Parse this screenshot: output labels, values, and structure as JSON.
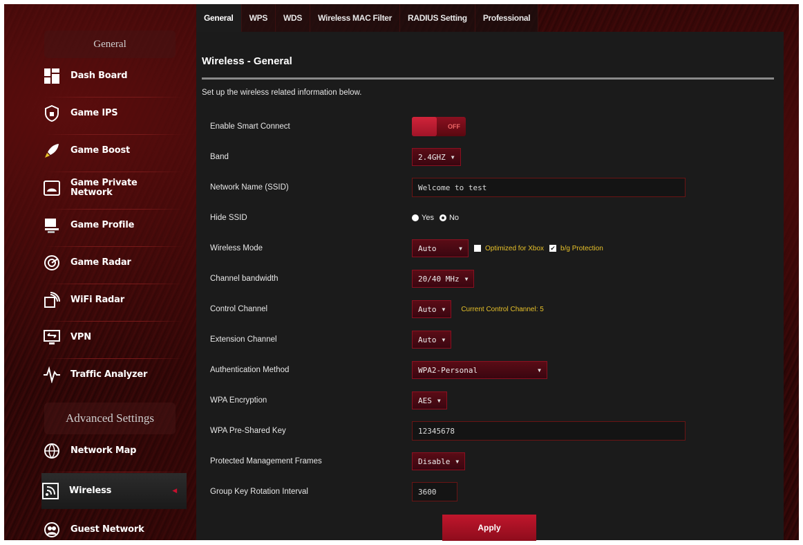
{
  "sidebar": {
    "general_header": "General",
    "advanced_header": "Advanced Settings",
    "items": [
      {
        "label": "Dash Board",
        "icon": "dashboard-icon"
      },
      {
        "label": "Game IPS",
        "icon": "shield-icon"
      },
      {
        "label": "Game Boost",
        "icon": "rocket-icon"
      },
      {
        "label": "Game Private Network",
        "icon": "private-network-icon"
      },
      {
        "label": "Game Profile",
        "icon": "profile-icon"
      },
      {
        "label": "Game Radar",
        "icon": "radar-icon"
      },
      {
        "label": "WiFi Radar",
        "icon": "wifi-radar-icon"
      },
      {
        "label": "VPN",
        "icon": "vpn-icon"
      },
      {
        "label": "Traffic Analyzer",
        "icon": "traffic-analyzer-icon"
      }
    ],
    "advanced_items": [
      {
        "label": "Network Map",
        "icon": "network-map-icon"
      },
      {
        "label": "Wireless",
        "icon": "wireless-icon",
        "active": true
      },
      {
        "label": "Guest Network",
        "icon": "guest-network-icon"
      }
    ]
  },
  "tabs": [
    "General",
    "WPS",
    "WDS",
    "Wireless MAC Filter",
    "RADIUS Setting",
    "Professional"
  ],
  "panel": {
    "title": "Wireless - General",
    "description": "Set up the wireless related information below."
  },
  "fields": {
    "smart_connect": {
      "label": "Enable Smart Connect",
      "state": "OFF"
    },
    "band": {
      "label": "Band",
      "value": "2.4GHZ"
    },
    "ssid": {
      "label": "Network Name (SSID)",
      "value": "Welcome to test"
    },
    "hide_ssid": {
      "label": "Hide SSID",
      "yes": "Yes",
      "no": "No",
      "selected": "No"
    },
    "wireless_mode": {
      "label": "Wireless Mode",
      "value": "Auto",
      "xbox_label": "Optimized for Xbox",
      "xbox_checked": false,
      "bg_label": "b/g Protection",
      "bg_checked": true
    },
    "channel_bandwidth": {
      "label": "Channel bandwidth",
      "value": "20/40 MHz"
    },
    "control_channel": {
      "label": "Control Channel",
      "value": "Auto",
      "note": "Current Control Channel: 5"
    },
    "extension_channel": {
      "label": "Extension Channel",
      "value": "Auto"
    },
    "auth_method": {
      "label": "Authentication Method",
      "value": "WPA2-Personal"
    },
    "wpa_encryption": {
      "label": "WPA Encryption",
      "value": "AES"
    },
    "wpa_key": {
      "label": "WPA Pre-Shared Key",
      "value": "12345678"
    },
    "pmf": {
      "label": "Protected Management Frames",
      "value": "Disable"
    },
    "gk_interval": {
      "label": "Group Key Rotation Interval",
      "value": "3600"
    }
  },
  "apply_label": "Apply",
  "colors": {
    "accent": "#c0162c",
    "panel": "#1b1b1b",
    "note": "#e8c22a"
  }
}
